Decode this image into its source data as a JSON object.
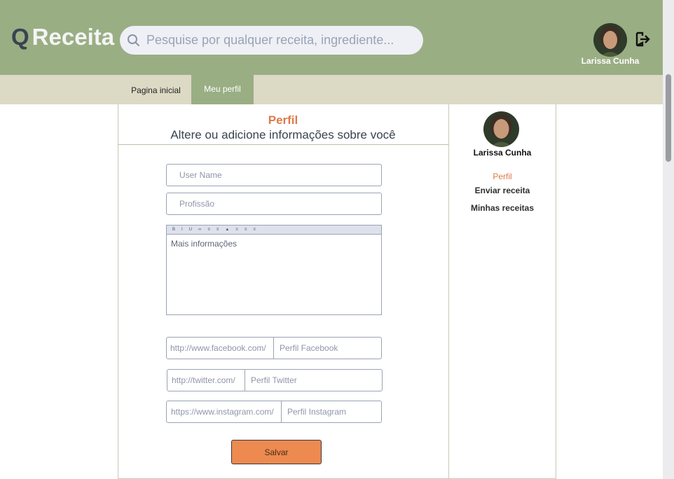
{
  "header": {
    "logo_q": "Q",
    "logo_name": "Receita",
    "search_placeholder": "Pesquise por qualquer receita, ingrediente...",
    "username": "Larissa Cunha"
  },
  "tabs": [
    {
      "label": "Pagina inicial"
    },
    {
      "label": "Meu perfil"
    }
  ],
  "profile": {
    "title": "Perfil",
    "subtitle": "Altere ou adicione informações sobre você",
    "username_placeholder": "User Name",
    "profession_placeholder": "Profissão",
    "editor_placeholder": "Mais informações",
    "facebook_prefix": "http://www.facebook.com/",
    "facebook_placeholder": "Perfil Facebook",
    "twitter_prefix": "http://twitter.com/",
    "twitter_placeholder": "Perfil Twitter",
    "instagram_prefix": "https://www.instagram.com/",
    "instagram_placeholder": "Perfil Instagram",
    "save_label": "Salvar"
  },
  "sidebar": {
    "username": "Larissa Cunha",
    "links": [
      {
        "label": "Perfil"
      },
      {
        "label": "Enviar receita"
      },
      {
        "label": "Minhas receitas"
      }
    ]
  },
  "colors": {
    "header_green": "#9aae84",
    "tab_bar": "#dcdac5",
    "accent_orange": "#dc7a4b",
    "button_orange": "#ec8a50"
  },
  "icons": [
    "search-icon",
    "logout-icon",
    "avatar"
  ]
}
